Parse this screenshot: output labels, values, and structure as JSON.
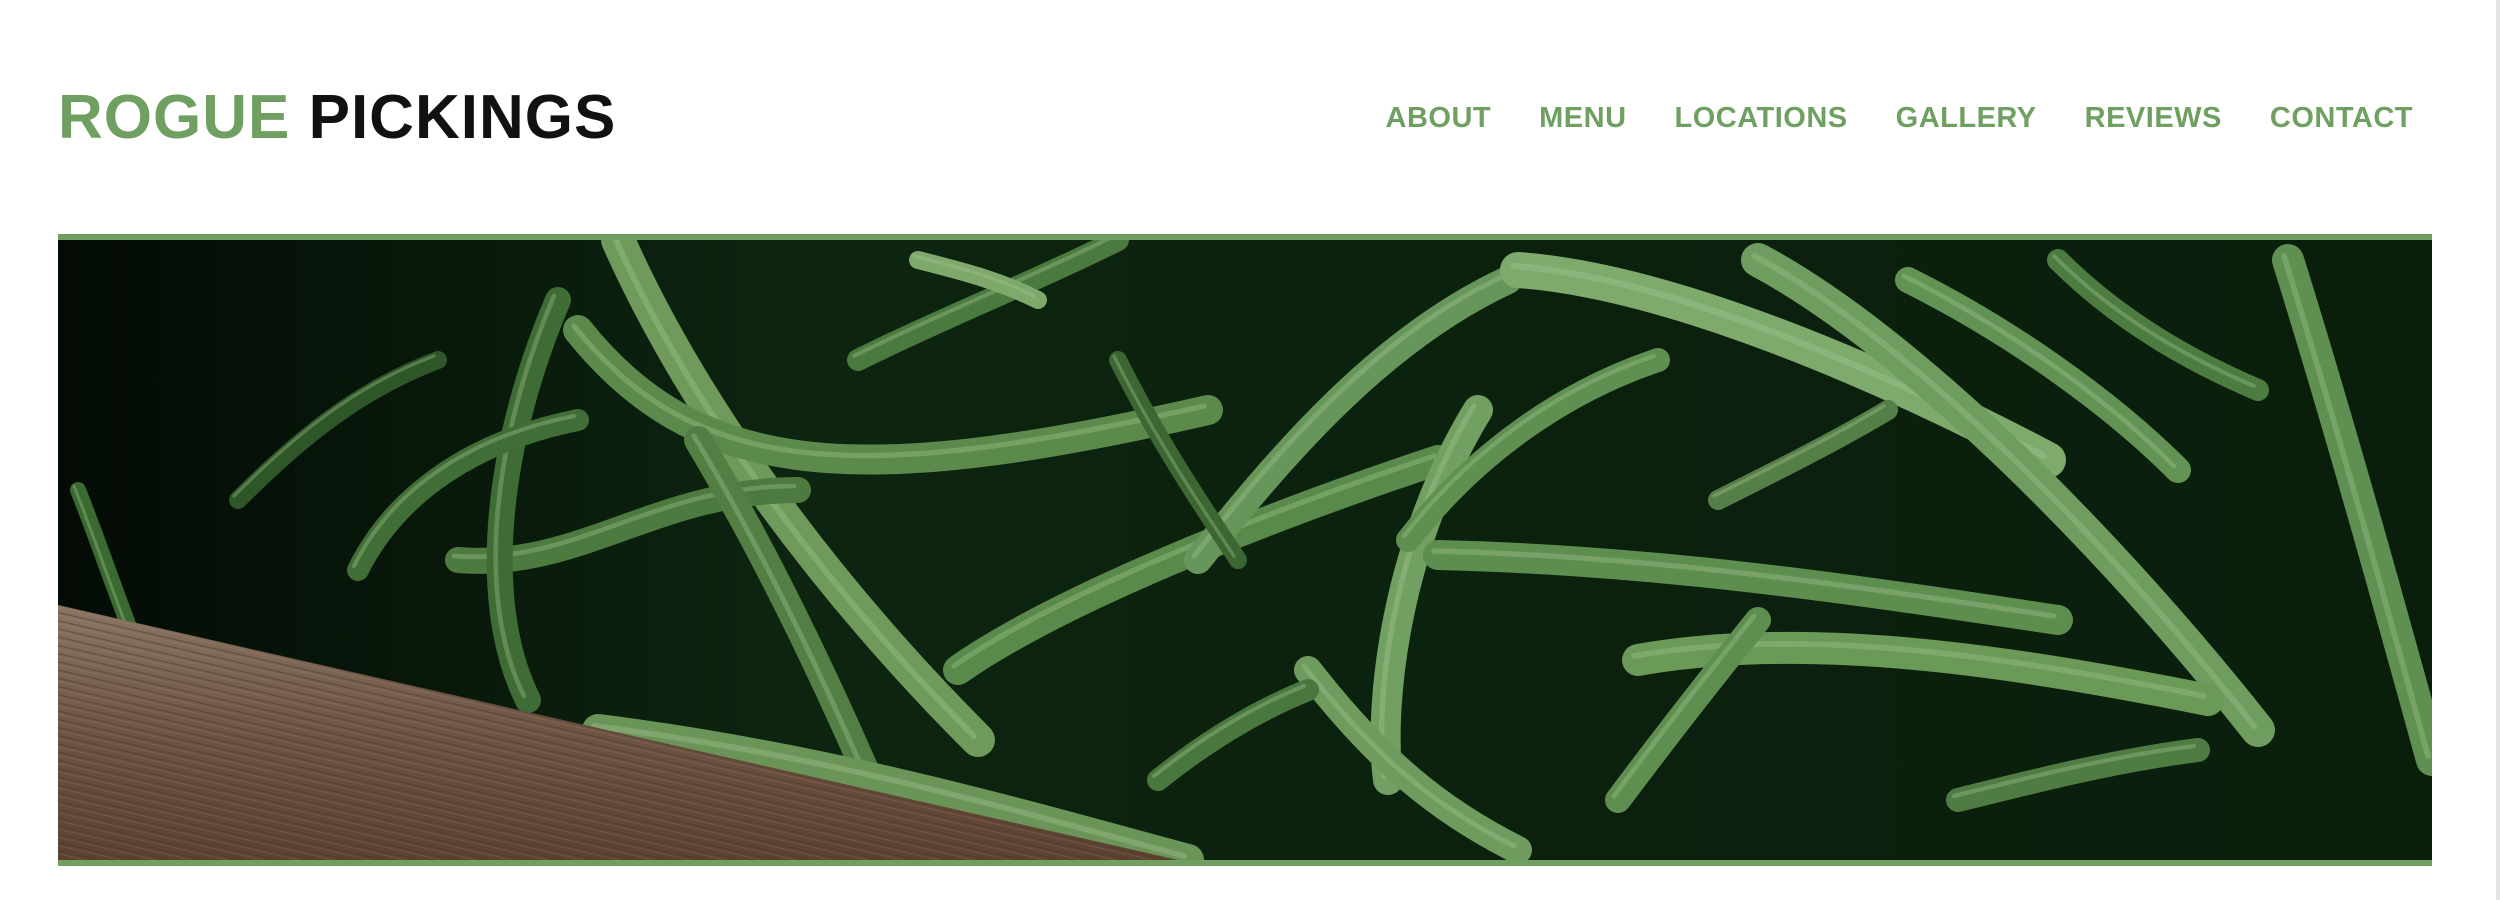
{
  "brand": {
    "word1": "ROGUE",
    "word2": "PICKINGS",
    "accent_color": "#6fa062",
    "dark_color": "#111111"
  },
  "nav": {
    "items": [
      {
        "label": "ABOUT"
      },
      {
        "label": "MENU"
      },
      {
        "label": "LOCATIONS"
      },
      {
        "label": "GALLERY"
      },
      {
        "label": "REVIEWS"
      },
      {
        "label": "CONTACT"
      }
    ]
  },
  "hero": {
    "subject": "green-beans-photo"
  }
}
